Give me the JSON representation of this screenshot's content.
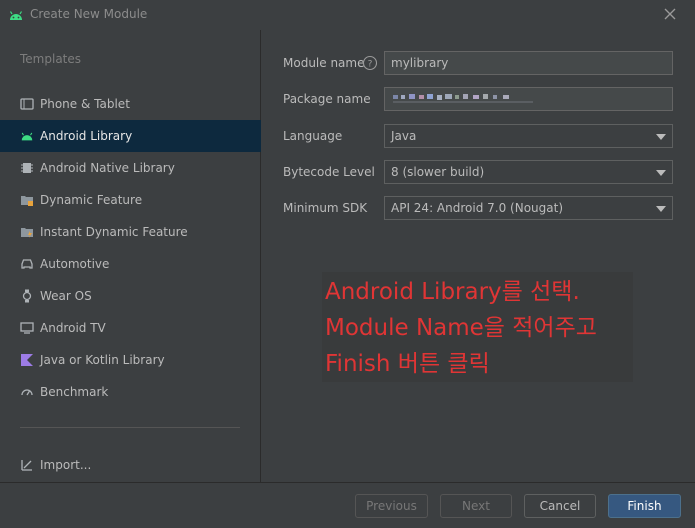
{
  "window": {
    "title": "Create New Module",
    "brand_color": "#3ddc84"
  },
  "sidebar": {
    "header": "Templates",
    "items": [
      {
        "label": "Phone & Tablet",
        "icon": "phone-icon"
      },
      {
        "label": "Android Library",
        "icon": "android-icon",
        "selected": true
      },
      {
        "label": "Android Native Library",
        "icon": "chip-icon"
      },
      {
        "label": "Dynamic Feature",
        "icon": "folder-module-icon"
      },
      {
        "label": "Instant Dynamic Feature",
        "icon": "folder-instant-icon"
      },
      {
        "label": "Automotive",
        "icon": "car-icon"
      },
      {
        "label": "Wear OS",
        "icon": "watch-icon"
      },
      {
        "label": "Android TV",
        "icon": "tv-icon"
      },
      {
        "label": "Java or Kotlin Library",
        "icon": "kotlin-icon"
      },
      {
        "label": "Benchmark",
        "icon": "gauge-icon"
      }
    ],
    "import_label": "Import..."
  },
  "form": {
    "module_name": {
      "label": "Module name",
      "value": "mylibrary"
    },
    "package_name": {
      "label": "Package name"
    },
    "language": {
      "label": "Language",
      "value": "Java"
    },
    "bytecode": {
      "label": "Bytecode Level",
      "value": "8 (slower build)"
    },
    "min_sdk": {
      "label": "Minimum SDK",
      "value": "API 24: Android 7.0 (Nougat)"
    }
  },
  "annotation": {
    "line1": "Android Library를 선택.",
    "line2": "Module Name을 적어주고",
    "line3": "Finish 버튼 클릭",
    "color": "#e03535"
  },
  "footer": {
    "previous": "Previous",
    "next": "Next",
    "cancel": "Cancel",
    "finish": "Finish"
  }
}
